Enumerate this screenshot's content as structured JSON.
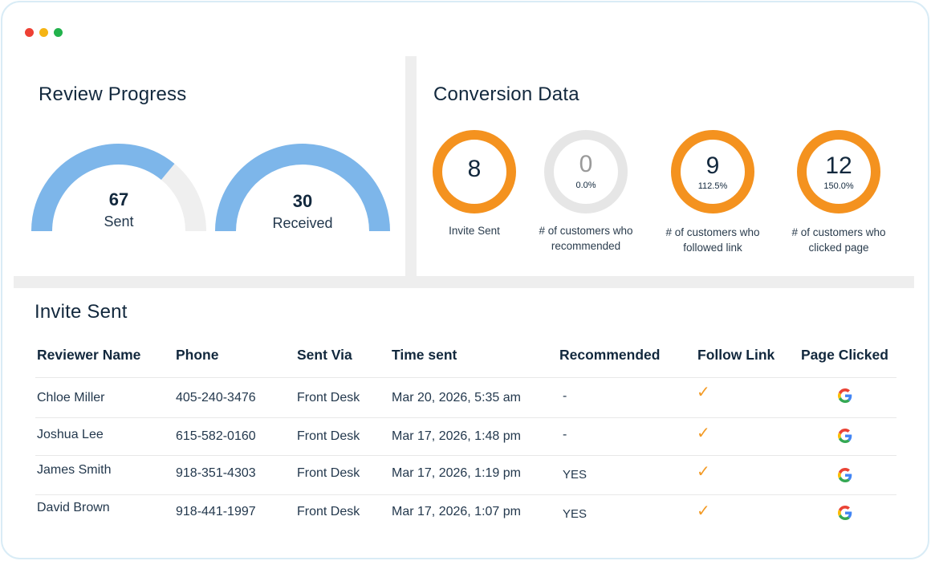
{
  "window": {
    "dot_colors": [
      "#ee4034",
      "#f5b414",
      "#22b24c"
    ]
  },
  "review_progress": {
    "title": "Review Progress",
    "sent": {
      "value": "67",
      "label": "Sent",
      "fill": 0.72
    },
    "received": {
      "value": "30",
      "label": "Received",
      "fill": 1.0
    }
  },
  "conversion": {
    "title": "Conversion Data",
    "items": [
      {
        "value": "8",
        "percent": "",
        "label_line1": "Invite Sent",
        "label_line2": "",
        "active": true
      },
      {
        "value": "0",
        "percent": "0.0%",
        "label_line1": "# of customers who",
        "label_line2": "recommended",
        "active": false
      },
      {
        "value": "9",
        "percent": "112.5%",
        "label_line1": "# of customers who",
        "label_line2": "followed link",
        "active": true
      },
      {
        "value": "12",
        "percent": "150.0%",
        "label_line1": "# of customers who",
        "label_line2": "clicked page",
        "active": true
      }
    ]
  },
  "table": {
    "title": "Invite Sent",
    "headers": [
      "Reviewer Name",
      "Phone",
      "Sent Via",
      "Time sent",
      "Recommended",
      "Follow Link",
      "Page Clicked"
    ],
    "rows": [
      {
        "name": "Chloe Miller",
        "phone": "405-240-3476",
        "via": "Front Desk",
        "time": "Mar 20, 2026, 5:35 am",
        "recommended": "-",
        "follow": "✓",
        "page": "google-icon"
      },
      {
        "name": "Joshua Lee",
        "phone": "615-582-0160",
        "via": "Front Desk",
        "time": "Mar 17, 2026, 1:48 pm",
        "recommended": "-",
        "follow": "✓",
        "page": "google-icon"
      },
      {
        "name": "James Smith",
        "phone": "918-351-4303",
        "via": "Front Desk",
        "time": "Mar 17, 2026, 1:19 pm",
        "recommended": "YES",
        "follow": "✓",
        "page": "google-icon"
      },
      {
        "name": "David Brown",
        "phone": "918-441-1997",
        "via": "Front Desk",
        "time": "Mar 17, 2026, 1:07 pm",
        "recommended": "YES",
        "follow": "✓",
        "page": "google-icon"
      }
    ]
  },
  "colors": {
    "gauge_fill": "#7db6ea",
    "gauge_track": "#efefef",
    "ring_active": "#f4921f",
    "ring_inactive": "#e6e6e6",
    "check": "#f39a24"
  }
}
